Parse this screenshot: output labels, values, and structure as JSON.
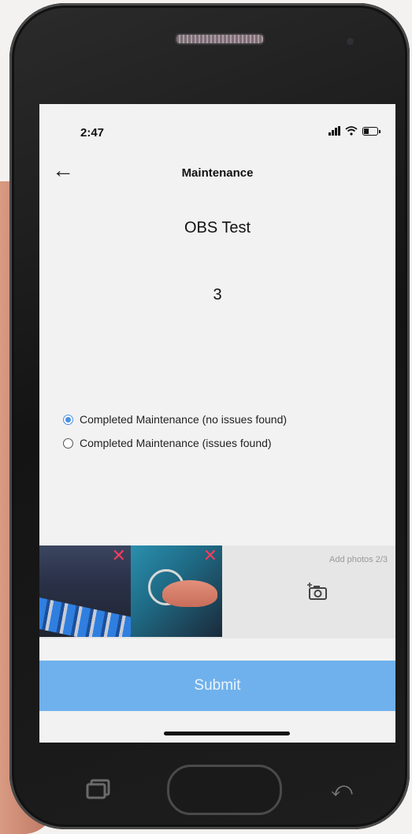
{
  "status_bar": {
    "time": "2:47"
  },
  "header": {
    "title": "Maintenance"
  },
  "record": {
    "name": "OBS Test",
    "count": "3"
  },
  "options": [
    {
      "label": "Completed Maintenance (no issues found)",
      "selected": true
    },
    {
      "label": "Completed Maintenance (issues found)",
      "selected": false
    }
  ],
  "photos": {
    "add_label": "Add photos 2/3"
  },
  "actions": {
    "submit_label": "Submit"
  },
  "colors": {
    "accent": "#4a90e2",
    "submit_bg": "#6fb1ec",
    "remove": "#ff3b5c"
  }
}
